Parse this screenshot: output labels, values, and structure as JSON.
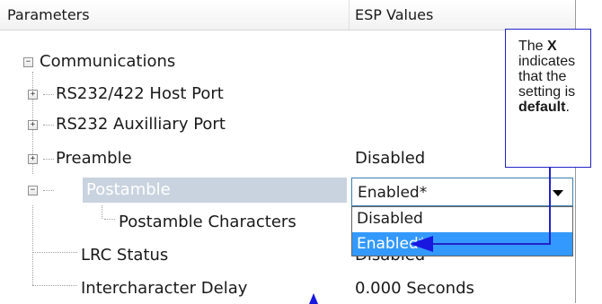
{
  "header": {
    "col_params": "Parameters",
    "col_values": "ESP Values"
  },
  "tree": {
    "root": {
      "label": "Communications",
      "expander": "−"
    },
    "items": [
      {
        "label": "RS232/422 Host Port",
        "value": "",
        "expander": "+"
      },
      {
        "label": "RS232 Auxilliary Port",
        "value": "",
        "expander": "+"
      },
      {
        "label": "Preamble",
        "value": "Disabled",
        "expander": "+"
      },
      {
        "label": "Postamble",
        "value": "",
        "expander": "−"
      },
      {
        "label": "Postamble Characters",
        "value": ""
      },
      {
        "label": "LRC Status",
        "value": "Disabled"
      },
      {
        "label": "Intercharacter Delay",
        "value": "0.000 Seconds"
      }
    ]
  },
  "combo": {
    "selected": "Enabled*"
  },
  "dropdown": {
    "options": [
      "Disabled",
      "Enabled*"
    ],
    "highlighted_index": 1
  },
  "callout": {
    "pre": "The",
    "key": "X",
    "mid": "indicates that the setting is",
    "bold_word": "default",
    "post": "."
  },
  "colors": {
    "accent": "#3399ff",
    "callout": "#2323c8",
    "selection": "#c9d3df"
  }
}
